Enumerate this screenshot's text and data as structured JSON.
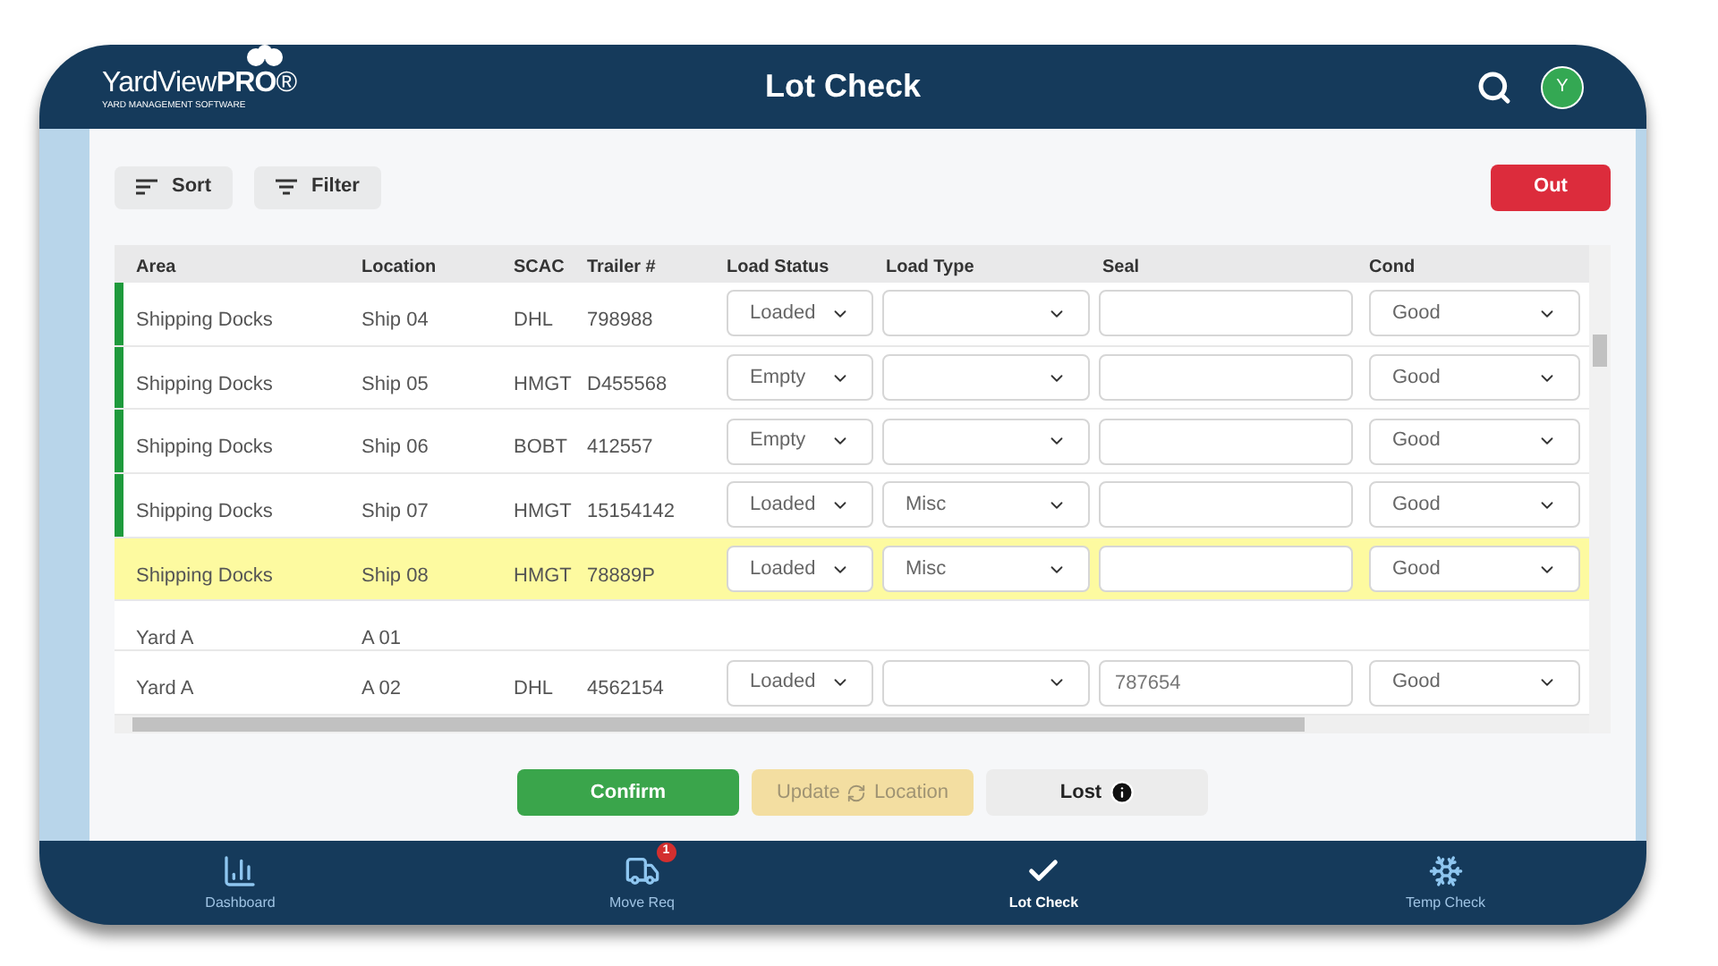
{
  "app": {
    "logo": "YardView**PRO**®",
    "logo_tagline": "YARD MANAGEMENT SOFTWARE",
    "title": "Lot Check",
    "avatar": "Y"
  },
  "toolbar": {
    "sort": "Sort",
    "filter": "Filter",
    "out": "Out"
  },
  "table": {
    "columns": [
      "Area",
      "Location",
      "SCAC",
      "Trailer #",
      "Load Status",
      "Load Type",
      "Seal",
      "Cond"
    ],
    "rows": [
      {
        "kind": "trailer",
        "marked": true,
        "selected": false,
        "area": "Shipping Docks",
        "location": "Ship 04",
        "scac": "DHL",
        "trailer": "798988",
        "load_status": "Loaded",
        "cond": "Good"
      },
      {
        "kind": "trailer",
        "marked": true,
        "selected": false,
        "area": "Shipping Docks",
        "location": "Ship 05",
        "scac": "HMGT",
        "trailer": "D455568",
        "load_status": "Empty",
        "cond": "Good"
      },
      {
        "kind": "trailer",
        "marked": true,
        "selected": false,
        "area": "Shipping Docks",
        "location": "Ship 06",
        "scac": "BOBT",
        "trailer": "412557",
        "load_status": "Empty",
        "cond": "Good"
      },
      {
        "kind": "trailer",
        "marked": true,
        "selected": false,
        "area": "Shipping Docks",
        "location": "Ship 07",
        "scac": "HMGT",
        "trailer": "15154142",
        "load_status": "Loaded",
        "load_type": "Misc",
        "cond": "Good"
      },
      {
        "kind": "trailer",
        "marked": false,
        "selected": true,
        "area": "Shipping Docks",
        "location": "Ship 08",
        "scac": "HMGT",
        "trailer": "78889P",
        "load_status": "Loaded",
        "load_type": "Misc",
        "cond": "Good"
      },
      {
        "kind": "vacant",
        "marked": false,
        "selected": false,
        "area": "Yard A",
        "location": "A 01"
      },
      {
        "kind": "trailer",
        "marked": false,
        "selected": false,
        "area": "Yard A",
        "location": "A 02",
        "scac": "DHL",
        "trailer": "4562154",
        "load_status": "Loaded",
        "seal": "787654",
        "cond": "Good"
      }
    ]
  },
  "actions": [
    {
      "kind": "confirm",
      "label": "Confirm",
      "disabled": false
    },
    {
      "kind": "update",
      "label_before": "Update",
      "label_after": "Location",
      "disabled": true
    },
    {
      "kind": "lost",
      "label": "Lost",
      "disabled": false
    }
  ],
  "nav": [
    {
      "kind": "dashboard",
      "label": "Dashboard",
      "selected": false
    },
    {
      "kind": "move",
      "label": "Move Req",
      "badge": "1",
      "selected": false
    },
    {
      "kind": "check",
      "label": "Lot Check",
      "selected": true
    },
    {
      "kind": "temp",
      "label": "Temp Check",
      "selected": false
    }
  ]
}
